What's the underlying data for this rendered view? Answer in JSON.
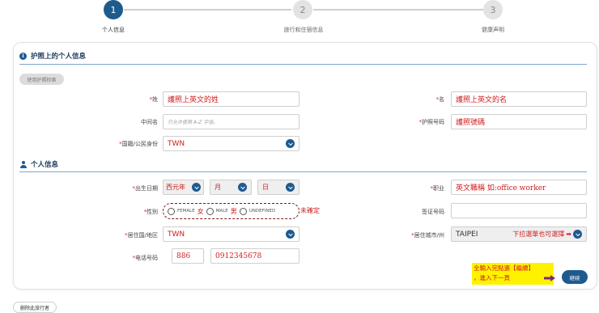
{
  "stepper": {
    "steps": [
      {
        "number": "1",
        "label": "个人信息"
      },
      {
        "number": "2",
        "label": "旅行和住宿信息"
      },
      {
        "number": "3",
        "label": "健康声明"
      }
    ]
  },
  "passport_section": {
    "title": "护照上的个人信息",
    "scan_button": "使用护照检索",
    "surname": {
      "label": "姓",
      "value": "護照上英文的姓"
    },
    "given_name": {
      "label": "名",
      "value": "護照上英文的名"
    },
    "middle_name": {
      "label": "中间名",
      "placeholder": "只允许使用 A-Z 字母。"
    },
    "passport_number": {
      "label": "护照号码",
      "value": "護照號碼"
    },
    "nationality": {
      "label": "国籍/公民身份",
      "value": "TWN"
    }
  },
  "personal_section": {
    "title": "个人信息",
    "birth_date": {
      "label": "出生日期",
      "year": "西元年",
      "month": "月",
      "day": "日"
    },
    "occupation": {
      "label": "职业",
      "value": "英文職稱 如:office worker"
    },
    "gender": {
      "label": "性别",
      "options": [
        {
          "label": "FEMALE",
          "cn": "女"
        },
        {
          "label": "MALE",
          "cn": "男"
        },
        {
          "label": "UNDEFINED",
          "cn": ""
        }
      ],
      "note": "未確定"
    },
    "visa_number": {
      "label": "签证号码",
      "value": ""
    },
    "country_of_residence": {
      "label": "居住国/地区",
      "value": "TWN"
    },
    "city_of_residence": {
      "label": "居住城市/州",
      "value": "TAIPEI",
      "note": "下拉選單也可選擇"
    },
    "phone": {
      "label": "电话号码",
      "plus": "+",
      "country_code": "886",
      "number": "0912345678"
    }
  },
  "annotation": {
    "line1": "全輸入完點選【繼續】",
    "line2": "，進入下一頁"
  },
  "continue_button": "继续",
  "remove_traveler_button": "删除此旅行者",
  "colors": {
    "primary": "#1d5b8f",
    "annotation": "#d01c1c",
    "highlight": "#fff200"
  }
}
